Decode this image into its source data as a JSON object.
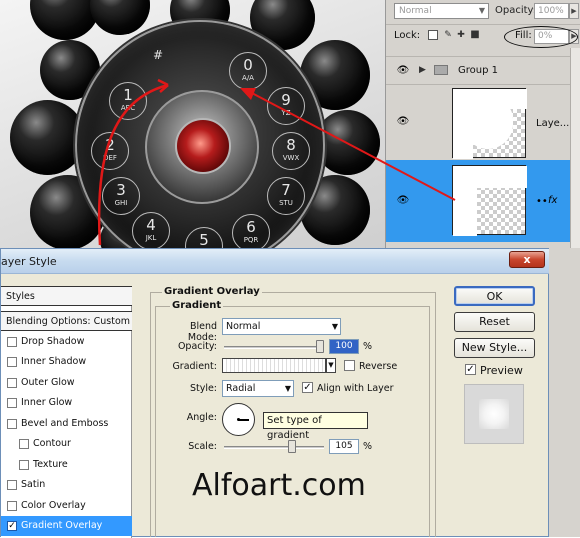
{
  "layers_panel": {
    "blend_mode": "Normal",
    "opacity_label": "Opacity:",
    "opacity_value": "100%",
    "lock_label": "Lock:",
    "fill_label": "Fill:",
    "fill_value": "0%",
    "group_name": "Group 1",
    "layer_name": "Laye...",
    "fx": "fx"
  },
  "dial": {
    "digits": [
      {
        "n": "1",
        "l": "ABC"
      },
      {
        "n": "2",
        "l": "DEF"
      },
      {
        "n": "3",
        "l": "GHI"
      },
      {
        "n": "4",
        "l": "JKL"
      },
      {
        "n": "5",
        "l": ""
      },
      {
        "n": "6",
        "l": "PQR"
      },
      {
        "n": "7",
        "l": "STU"
      },
      {
        "n": "8",
        "l": "VWX"
      },
      {
        "n": "9",
        "l": "YZ"
      },
      {
        "n": "0",
        "l": "A/A"
      }
    ],
    "hash": "#",
    "star": "∗"
  },
  "dialog": {
    "title": "ayer Style",
    "close": "x",
    "styles_header": "Styles",
    "blending_header": "Blending Options: Custom",
    "styles": [
      {
        "label": "Drop Shadow",
        "checked": false
      },
      {
        "label": "Inner Shadow",
        "checked": false
      },
      {
        "label": "Outer Glow",
        "checked": false
      },
      {
        "label": "Inner Glow",
        "checked": false
      },
      {
        "label": "Bevel and Emboss",
        "checked": false
      },
      {
        "label": "Contour",
        "checked": false
      },
      {
        "label": "Texture",
        "checked": false
      },
      {
        "label": "Satin",
        "checked": false
      },
      {
        "label": "Color Overlay",
        "checked": false
      },
      {
        "label": "Gradient Overlay",
        "checked": true
      }
    ],
    "section_title": "Gradient Overlay",
    "subsection_title": "Gradient",
    "blend_mode_label": "Blend Mode:",
    "blend_mode_value": "Normal",
    "opacity_label": "Opacity:",
    "opacity_value": "100",
    "opacity_percent": 100,
    "percent": "%",
    "gradient_label": "Gradient:",
    "reverse_label": "Reverse",
    "style_label": "Style:",
    "style_value": "Radial",
    "align_label": "Align with Layer",
    "angle_label": "Angle:",
    "tooltip": "Set type of gradient",
    "scale_label": "Scale:",
    "scale_value": "105",
    "scale_percent": 105,
    "ok": "OK",
    "reset": "Reset",
    "new_style": "New Style...",
    "preview_label": "Preview"
  },
  "watermark": "Alfoart.com"
}
